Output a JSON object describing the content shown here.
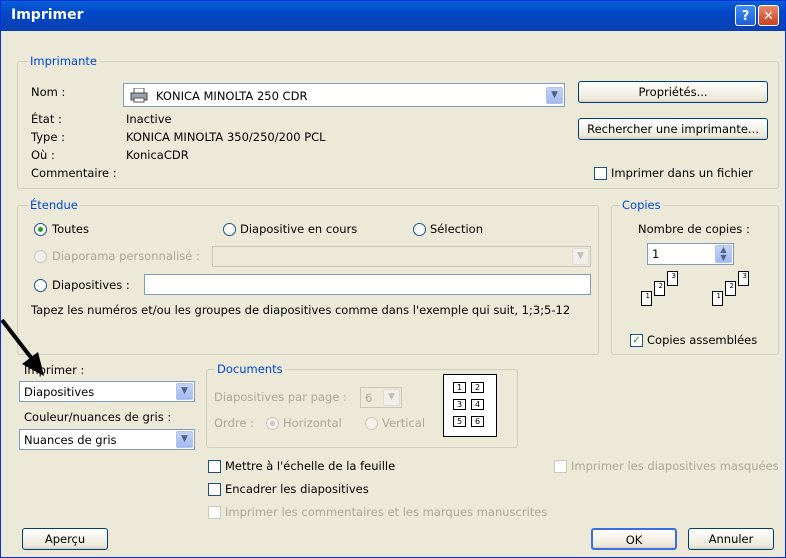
{
  "dialog": {
    "title": "Imprimer",
    "help_label": "?",
    "close_label": "✕"
  },
  "printer": {
    "legend": "Imprimante",
    "name_label": "Nom :",
    "name_value": "KONICA MINOLTA 250 CDR",
    "status_label": "État :",
    "status_value": "Inactive",
    "type_label": "Type :",
    "type_value": "KONICA MINOLTA 350/250/200 PCL",
    "where_label": "Où :",
    "where_value": "KonicaCDR",
    "comment_label": "Commentaire :",
    "properties_button": "Propriétés...",
    "find_printer_button": "Rechercher une imprimante...",
    "print_to_file_label": "Imprimer dans un fichier",
    "print_to_file_checked": false
  },
  "range": {
    "legend": "Étendue",
    "all_label": "Toutes",
    "current_slide_label": "Diapositive en cours",
    "selection_label": "Sélection",
    "custom_show_label": "Diaporama personnalisé :",
    "slides_label": "Diapositives :",
    "hint": "Tapez les numéros et/ou les groupes de diapositives comme dans l'exemple qui suit, 1;3;5-12",
    "selected": "Toutes"
  },
  "copies": {
    "legend": "Copies",
    "count_label": "Nombre de copies :",
    "count_value": "1",
    "collate_label": "Copies assemblées",
    "collate_checked": true
  },
  "print_what": {
    "label": "Imprimer :",
    "value": "Diapositives"
  },
  "color": {
    "label": "Couleur/nuances de gris :",
    "value": "Nuances de gris"
  },
  "handouts": {
    "legend": "Documents",
    "per_page_label": "Diapositives par page :",
    "per_page_value": "6",
    "order_label": "Ordre :",
    "horizontal_label": "Horizontal",
    "vertical_label": "Vertical",
    "preview_cells": [
      "1",
      "2",
      "3",
      "4",
      "5",
      "6"
    ]
  },
  "options": {
    "scale_to_fit": "Mettre à l'échelle de la feuille",
    "frame_slides": "Encadrer les diapositives",
    "print_comments": "Imprimer les commentaires et les marques manuscrites",
    "print_hidden": "Imprimer les diapositives masquées"
  },
  "buttons": {
    "preview": "Aperçu",
    "ok": "OK",
    "cancel": "Annuler"
  },
  "icons": {
    "printer": "printer-icon",
    "dropdown": "chevron-down-icon",
    "pointer": "arrow-pointer-icon"
  },
  "colors": {
    "title_bar": "#0a5fd8",
    "group_legend": "#0046d5",
    "accent_check": "#21a121"
  }
}
